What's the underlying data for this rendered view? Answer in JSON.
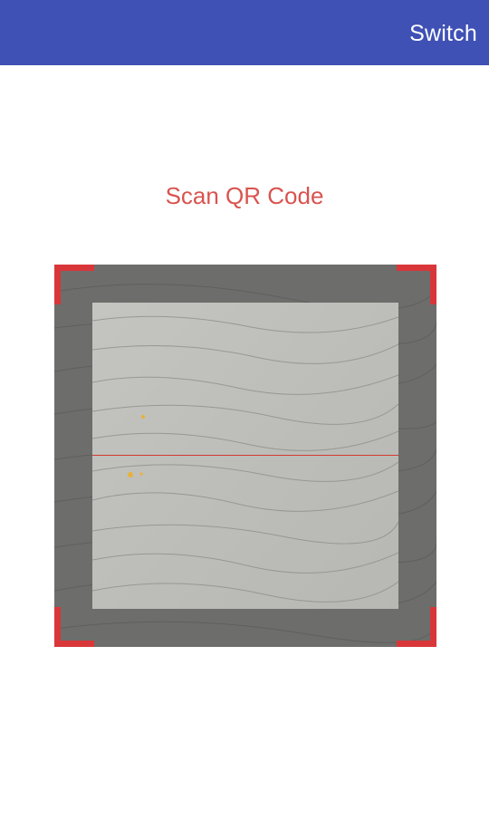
{
  "app_bar": {
    "switch_label": "Switch",
    "color": "#3f51b5"
  },
  "scanner": {
    "title": "Scan QR Code",
    "title_color": "#d9534f",
    "corner_color": "#d9363a",
    "scan_line_color": "#d23a32",
    "preview": "camera-preview"
  }
}
